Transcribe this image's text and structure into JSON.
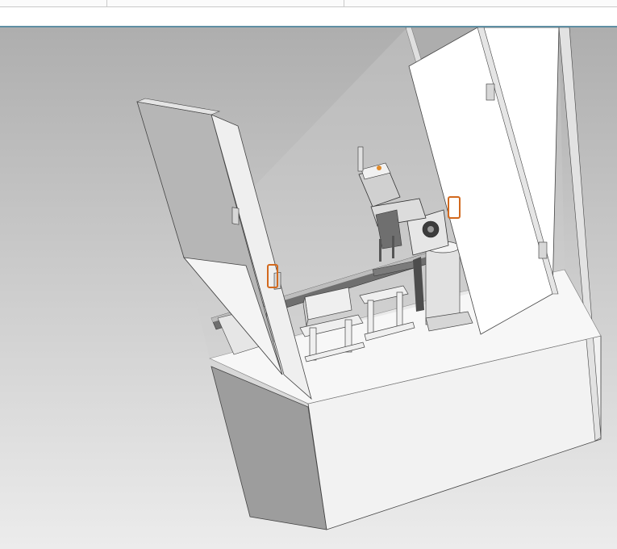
{
  "colors": {
    "accent_rule": "#5f8fa3",
    "viewport_top": "#aeaeae",
    "viewport_bottom": "#ececec"
  },
  "viewport": {
    "background": "gradient-gray",
    "model": "cnc-enclosure-with-open-doors"
  }
}
